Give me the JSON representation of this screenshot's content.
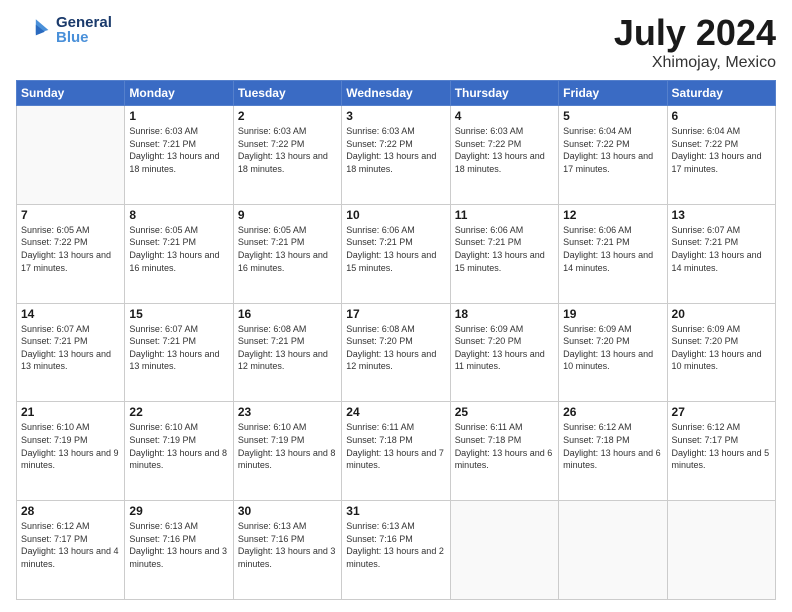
{
  "header": {
    "logo_general": "General",
    "logo_blue": "Blue",
    "title": "July 2024",
    "subtitle": "Xhimojay, Mexico"
  },
  "calendar": {
    "days_of_week": [
      "Sunday",
      "Monday",
      "Tuesday",
      "Wednesday",
      "Thursday",
      "Friday",
      "Saturday"
    ],
    "weeks": [
      [
        {
          "day": "",
          "sunrise": "",
          "sunset": "",
          "daylight": ""
        },
        {
          "day": "1",
          "sunrise": "Sunrise: 6:03 AM",
          "sunset": "Sunset: 7:21 PM",
          "daylight": "Daylight: 13 hours and 18 minutes."
        },
        {
          "day": "2",
          "sunrise": "Sunrise: 6:03 AM",
          "sunset": "Sunset: 7:22 PM",
          "daylight": "Daylight: 13 hours and 18 minutes."
        },
        {
          "day": "3",
          "sunrise": "Sunrise: 6:03 AM",
          "sunset": "Sunset: 7:22 PM",
          "daylight": "Daylight: 13 hours and 18 minutes."
        },
        {
          "day": "4",
          "sunrise": "Sunrise: 6:03 AM",
          "sunset": "Sunset: 7:22 PM",
          "daylight": "Daylight: 13 hours and 18 minutes."
        },
        {
          "day": "5",
          "sunrise": "Sunrise: 6:04 AM",
          "sunset": "Sunset: 7:22 PM",
          "daylight": "Daylight: 13 hours and 17 minutes."
        },
        {
          "day": "6",
          "sunrise": "Sunrise: 6:04 AM",
          "sunset": "Sunset: 7:22 PM",
          "daylight": "Daylight: 13 hours and 17 minutes."
        }
      ],
      [
        {
          "day": "7",
          "sunrise": "Sunrise: 6:05 AM",
          "sunset": "Sunset: 7:22 PM",
          "daylight": "Daylight: 13 hours and 17 minutes."
        },
        {
          "day": "8",
          "sunrise": "Sunrise: 6:05 AM",
          "sunset": "Sunset: 7:21 PM",
          "daylight": "Daylight: 13 hours and 16 minutes."
        },
        {
          "day": "9",
          "sunrise": "Sunrise: 6:05 AM",
          "sunset": "Sunset: 7:21 PM",
          "daylight": "Daylight: 13 hours and 16 minutes."
        },
        {
          "day": "10",
          "sunrise": "Sunrise: 6:06 AM",
          "sunset": "Sunset: 7:21 PM",
          "daylight": "Daylight: 13 hours and 15 minutes."
        },
        {
          "day": "11",
          "sunrise": "Sunrise: 6:06 AM",
          "sunset": "Sunset: 7:21 PM",
          "daylight": "Daylight: 13 hours and 15 minutes."
        },
        {
          "day": "12",
          "sunrise": "Sunrise: 6:06 AM",
          "sunset": "Sunset: 7:21 PM",
          "daylight": "Daylight: 13 hours and 14 minutes."
        },
        {
          "day": "13",
          "sunrise": "Sunrise: 6:07 AM",
          "sunset": "Sunset: 7:21 PM",
          "daylight": "Daylight: 13 hours and 14 minutes."
        }
      ],
      [
        {
          "day": "14",
          "sunrise": "Sunrise: 6:07 AM",
          "sunset": "Sunset: 7:21 PM",
          "daylight": "Daylight: 13 hours and 13 minutes."
        },
        {
          "day": "15",
          "sunrise": "Sunrise: 6:07 AM",
          "sunset": "Sunset: 7:21 PM",
          "daylight": "Daylight: 13 hours and 13 minutes."
        },
        {
          "day": "16",
          "sunrise": "Sunrise: 6:08 AM",
          "sunset": "Sunset: 7:21 PM",
          "daylight": "Daylight: 13 hours and 12 minutes."
        },
        {
          "day": "17",
          "sunrise": "Sunrise: 6:08 AM",
          "sunset": "Sunset: 7:20 PM",
          "daylight": "Daylight: 13 hours and 12 minutes."
        },
        {
          "day": "18",
          "sunrise": "Sunrise: 6:09 AM",
          "sunset": "Sunset: 7:20 PM",
          "daylight": "Daylight: 13 hours and 11 minutes."
        },
        {
          "day": "19",
          "sunrise": "Sunrise: 6:09 AM",
          "sunset": "Sunset: 7:20 PM",
          "daylight": "Daylight: 13 hours and 10 minutes."
        },
        {
          "day": "20",
          "sunrise": "Sunrise: 6:09 AM",
          "sunset": "Sunset: 7:20 PM",
          "daylight": "Daylight: 13 hours and 10 minutes."
        }
      ],
      [
        {
          "day": "21",
          "sunrise": "Sunrise: 6:10 AM",
          "sunset": "Sunset: 7:19 PM",
          "daylight": "Daylight: 13 hours and 9 minutes."
        },
        {
          "day": "22",
          "sunrise": "Sunrise: 6:10 AM",
          "sunset": "Sunset: 7:19 PM",
          "daylight": "Daylight: 13 hours and 8 minutes."
        },
        {
          "day": "23",
          "sunrise": "Sunrise: 6:10 AM",
          "sunset": "Sunset: 7:19 PM",
          "daylight": "Daylight: 13 hours and 8 minutes."
        },
        {
          "day": "24",
          "sunrise": "Sunrise: 6:11 AM",
          "sunset": "Sunset: 7:18 PM",
          "daylight": "Daylight: 13 hours and 7 minutes."
        },
        {
          "day": "25",
          "sunrise": "Sunrise: 6:11 AM",
          "sunset": "Sunset: 7:18 PM",
          "daylight": "Daylight: 13 hours and 6 minutes."
        },
        {
          "day": "26",
          "sunrise": "Sunrise: 6:12 AM",
          "sunset": "Sunset: 7:18 PM",
          "daylight": "Daylight: 13 hours and 6 minutes."
        },
        {
          "day": "27",
          "sunrise": "Sunrise: 6:12 AM",
          "sunset": "Sunset: 7:17 PM",
          "daylight": "Daylight: 13 hours and 5 minutes."
        }
      ],
      [
        {
          "day": "28",
          "sunrise": "Sunrise: 6:12 AM",
          "sunset": "Sunset: 7:17 PM",
          "daylight": "Daylight: 13 hours and 4 minutes."
        },
        {
          "day": "29",
          "sunrise": "Sunrise: 6:13 AM",
          "sunset": "Sunset: 7:16 PM",
          "daylight": "Daylight: 13 hours and 3 minutes."
        },
        {
          "day": "30",
          "sunrise": "Sunrise: 6:13 AM",
          "sunset": "Sunset: 7:16 PM",
          "daylight": "Daylight: 13 hours and 3 minutes."
        },
        {
          "day": "31",
          "sunrise": "Sunrise: 6:13 AM",
          "sunset": "Sunset: 7:16 PM",
          "daylight": "Daylight: 13 hours and 2 minutes."
        },
        {
          "day": "",
          "sunrise": "",
          "sunset": "",
          "daylight": ""
        },
        {
          "day": "",
          "sunrise": "",
          "sunset": "",
          "daylight": ""
        },
        {
          "day": "",
          "sunrise": "",
          "sunset": "",
          "daylight": ""
        }
      ]
    ]
  }
}
